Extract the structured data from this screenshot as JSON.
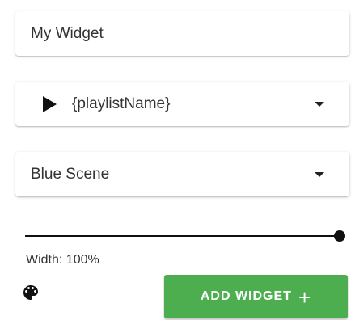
{
  "widget_name": {
    "value": "My Widget"
  },
  "playlist_select": {
    "selected": "{playlistName}",
    "icon": "play-icon"
  },
  "scene_select": {
    "selected": "Blue Scene"
  },
  "width_slider": {
    "value_percent": 100,
    "label": "Width: 100%"
  },
  "palette": {
    "icon": "palette-icon"
  },
  "add_button": {
    "label": "ADD WIDGET",
    "icon_glyph": "+",
    "color": "#4cae4f"
  }
}
